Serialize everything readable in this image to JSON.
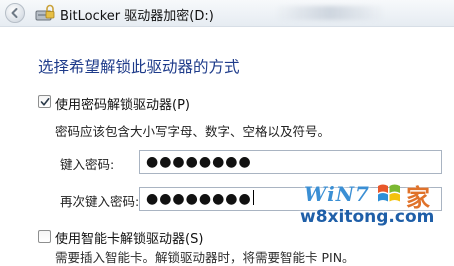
{
  "window": {
    "title": "BitLocker 驱动器加密(D:)"
  },
  "main": {
    "heading": "选择希望解锁此驱动器的方式",
    "password_option": {
      "label": "使用密码解锁驱动器(P)",
      "checked": true,
      "hint": "密码应该包含大小写字母、数字、空格以及符号。",
      "enter_label": "键入密码:",
      "enter_value": "●●●●●●●●",
      "reenter_label": "再次键入密码:",
      "reenter_value": "●●●●●●●●"
    },
    "smartcard_option": {
      "label": "使用智能卡解锁驱动器(S)",
      "checked": false,
      "hint": "需要插入智能卡。解锁驱动器时，将需要智能卡 PIN。"
    }
  },
  "watermark": {
    "logo_text": "WiN7",
    "logo_char": "家",
    "site": "w8xitong.com"
  },
  "colors": {
    "heading": "#1e3b8a",
    "watermark_blue": "#3b8fd4",
    "watermark_orange": "#e0722a",
    "field_border": "#a9b4c2"
  },
  "icons": {
    "back": "back-arrow-icon",
    "bitlocker": "bitlocker-drive-icon",
    "check": "checkmark-icon"
  }
}
